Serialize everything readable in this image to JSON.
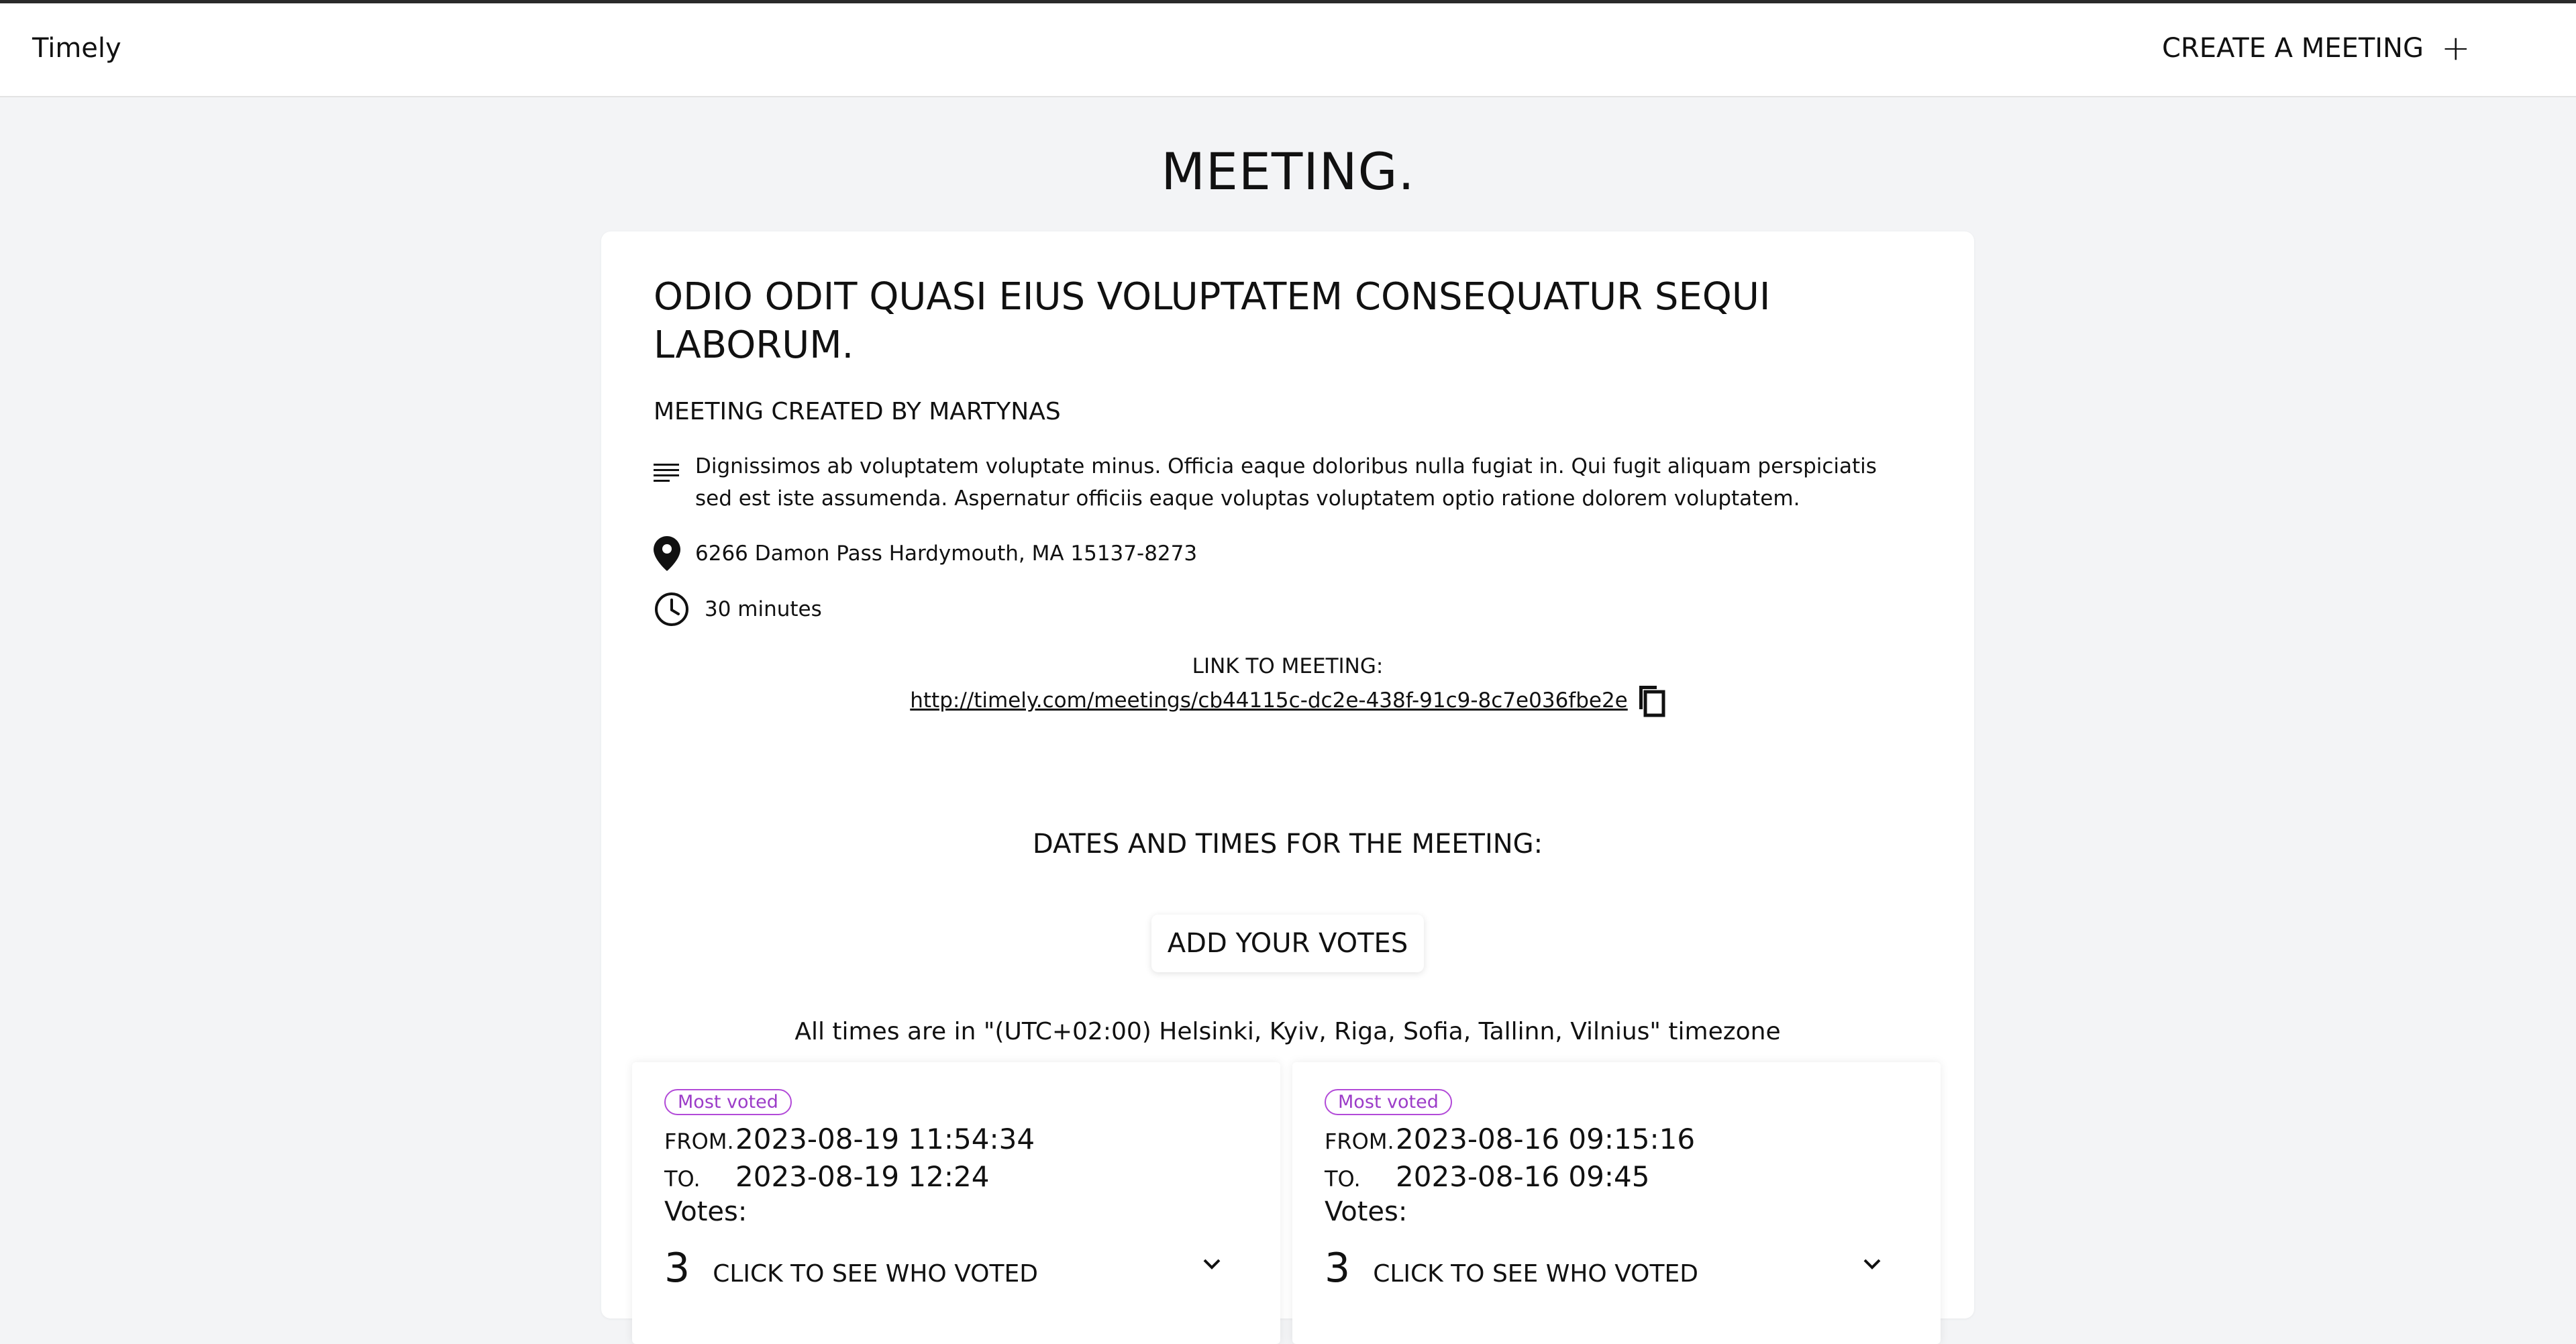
{
  "nav": {
    "brand": "Timely",
    "create_label": "CREATE A MEETING",
    "create_icon": "plus-icon"
  },
  "page": {
    "title": "MEETING."
  },
  "meeting": {
    "title": "ODIO ODIT QUASI EIUS VOLUPTATEM CONSEQUATUR SEQUI LABORUM.",
    "creator": "MEETING CREATED BY MARTYNAS",
    "description": "Dignissimos ab voluptatem voluptate minus. Officia eaque doloribus nulla fugiat in. Qui fugit aliquam perspiciatis sed est iste assumenda. Aspernatur officiis eaque voluptas voluptatem optio ratione dolorem voluptatem.",
    "location": "6266 Damon Pass Hardymouth, MA 15137-8273",
    "duration": "30 minutes",
    "link_label": "LINK TO MEETING:",
    "link": "http://timely.com/meetings/cb44115c-dc2e-438f-91c9-8c7e036fbe2e"
  },
  "dates": {
    "title": "DATES AND TIMES FOR THE MEETING:",
    "vote_button": "ADD YOUR VOTES",
    "timezone_note": "All times are in \"(UTC+02:00) Helsinki, Kyiv, Riga, Sofia, Tallinn, Vilnius\" timezone",
    "slots": [
      {
        "badge": "Most voted",
        "from_label": "FROM.",
        "from": "2023-08-19 11:54:34",
        "to_label": "TO.",
        "to": "2023-08-19 12:24",
        "votes_label": "Votes:",
        "count": "3",
        "see_label": "CLICK TO SEE WHO VOTED"
      },
      {
        "badge": "Most voted",
        "from_label": "FROM.",
        "from": "2023-08-16 09:15:16",
        "to_label": "TO.",
        "to": "2023-08-16 09:45",
        "votes_label": "Votes:",
        "count": "3",
        "see_label": "CLICK TO SEE WHO VOTED"
      }
    ]
  },
  "colors": {
    "badge": "#9c3cc8",
    "background": "#f3f4f6"
  }
}
